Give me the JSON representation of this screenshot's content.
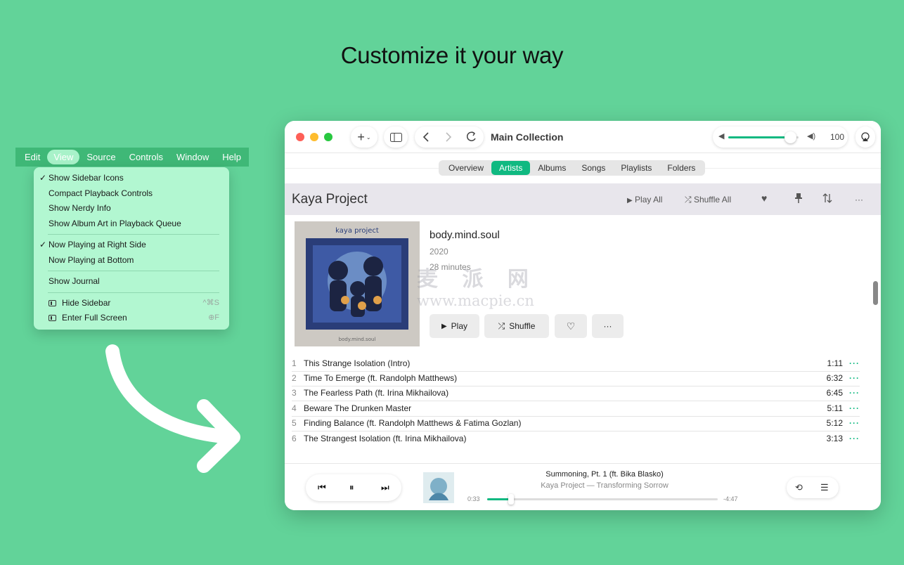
{
  "headline": "Customize it your way",
  "menubar": {
    "items": [
      "Edit",
      "View",
      "Source",
      "Controls",
      "Window",
      "Help"
    ],
    "active_index": 1
  },
  "view_menu": {
    "group1": [
      {
        "label": "Show Sidebar Icons",
        "checked": true
      },
      {
        "label": "Compact Playback Controls",
        "checked": false
      },
      {
        "label": "Show Nerdy Info",
        "checked": false
      },
      {
        "label": "Show Album Art in Playback Queue",
        "checked": false
      }
    ],
    "group2": [
      {
        "label": "Now Playing at Right Side",
        "checked": true
      },
      {
        "label": "Now Playing at Bottom",
        "checked": false
      }
    ],
    "group3": [
      {
        "label": "Show Journal",
        "checked": false
      }
    ],
    "group4": [
      {
        "label": "Hide Sidebar",
        "shortcut": "^⌘S",
        "icon": "sidebar-icon"
      },
      {
        "label": "Enter Full Screen",
        "shortcut": "⊕F",
        "icon": "fullscreen-icon"
      }
    ],
    "checkmark": "✓"
  },
  "toolbar": {
    "title": "Main Collection",
    "volume": 100,
    "volume_level": 0.88,
    "add_icon": "plus-icon",
    "chevron_icon": "chevron-down-icon"
  },
  "tabs": [
    "Overview",
    "Artists",
    "Albums",
    "Songs",
    "Playlists",
    "Folders"
  ],
  "active_tab": 1,
  "artist": {
    "name": "Kaya Project",
    "play_all": "Play All",
    "shuffle_all": "Shuffle All"
  },
  "album": {
    "title": "body.mind.soul",
    "year": "2020",
    "duration": "28 minutes",
    "cover_text_top": "kaya project",
    "cover_text_bottom": "body.mind.soul",
    "play_label": "Play",
    "shuffle_label": "Shuffle",
    "more_label": "···"
  },
  "watermark": {
    "cn": "麦 派 网",
    "url": "www.macpie.cn"
  },
  "tracks": [
    {
      "no": "1",
      "name": "This Strange Isolation (Intro)",
      "duration": "1:11"
    },
    {
      "no": "2",
      "name": "Time To Emerge (ft. Randolph Matthews)",
      "duration": "6:32"
    },
    {
      "no": "3",
      "name": "The Fearless Path (ft. Irina Mikhailova)",
      "duration": "6:45"
    },
    {
      "no": "4",
      "name": "Beware The Drunken Master",
      "duration": "5:11"
    },
    {
      "no": "5",
      "name": "Finding Balance (ft. Randolph Matthews & Fatima Gozlan)",
      "duration": "5:12"
    },
    {
      "no": "6",
      "name": "The Strangest Isolation (ft. Irina Mikhailova)",
      "duration": "3:13"
    }
  ],
  "track_more": "···",
  "player": {
    "title": "Summoning, Pt. 1 (ft. Bika Blasko)",
    "subtitle": "Kaya Project — Transforming Sorrow",
    "elapsed": "0:33",
    "remaining": "-4:47",
    "progress": 0.105
  },
  "colors": {
    "accent": "#10b981",
    "background": "#62d399",
    "menu_bg": "#b2f7d1"
  }
}
